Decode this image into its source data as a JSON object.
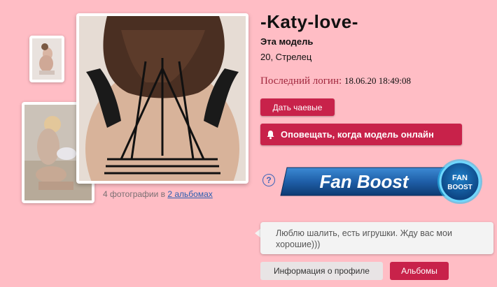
{
  "profile": {
    "name": "-Katy-love-",
    "model_label": "Эта модель",
    "age_sign": "20, Стрелец",
    "last_login_label": "Последний логин:",
    "last_login_value": "18.06.20 18:49:08"
  },
  "photos": {
    "caption_prefix": "4 фотографии в ",
    "albums_link": "2 альбомах"
  },
  "buttons": {
    "tip": "Дать чаевые",
    "notify": "Оповещать, когда модель онлайн"
  },
  "fanboost": {
    "banner_text": "Fan Boost",
    "badge_line1": "FAN",
    "badge_line2": "BOOST",
    "help_label": "?"
  },
  "bio": {
    "text": "Люблю шалить, есть игрушки. Жду вас мои хорошие)))"
  },
  "tabs": {
    "info": "Информация о профиле",
    "albums": "Альбомы"
  },
  "colors": {
    "background": "#ffbdc5",
    "accent_red": "#c8224a",
    "link_blue": "#2a5fb0"
  }
}
